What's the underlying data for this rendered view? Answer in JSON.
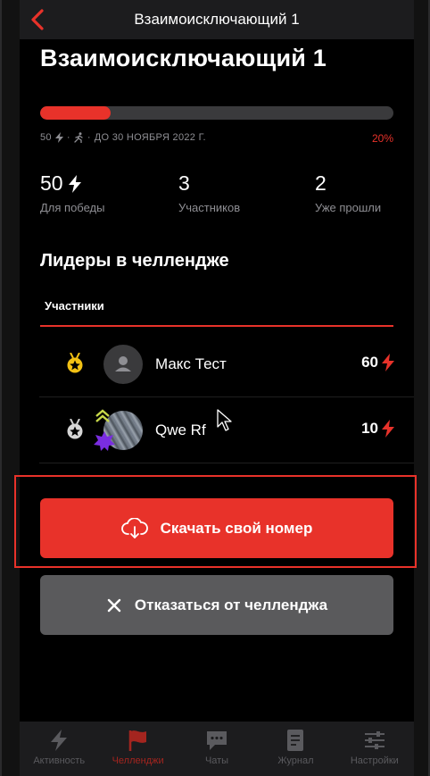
{
  "header": {
    "title": "Взаимоисключающий 1"
  },
  "page": {
    "title": "Взаимоисключающий 1"
  },
  "progress": {
    "value_percent": 20,
    "percent_label": "20%",
    "points": "50",
    "deadline": "ДО 30 НОЯБРЯ 2022 Г."
  },
  "stats": [
    {
      "value": "50",
      "label": "Для победы"
    },
    {
      "value": "3",
      "label": "Участников"
    },
    {
      "value": "2",
      "label": "Уже прошли"
    }
  ],
  "leaders": {
    "title": "Лидеры в челлендже",
    "tab_label": "Участники",
    "rows": [
      {
        "name": "Макс Тест",
        "score": "60"
      },
      {
        "name": "Qwe Rf",
        "score": "10"
      }
    ]
  },
  "actions": {
    "download_label": "Скачать свой номер",
    "quit_label": "Отказаться от челленджа"
  },
  "bottom_nav": [
    {
      "label": "Активность",
      "icon": "lightning-icon"
    },
    {
      "label": "Челленджи",
      "icon": "flag-icon",
      "active": true
    },
    {
      "label": "Чаты",
      "icon": "chat-icon"
    },
    {
      "label": "Журнал",
      "icon": "journal-icon"
    },
    {
      "label": "Настройки",
      "icon": "settings-icon"
    }
  ],
  "colors": {
    "accent": "#e8322a",
    "background": "#000000",
    "muted": "#8e8e93"
  }
}
